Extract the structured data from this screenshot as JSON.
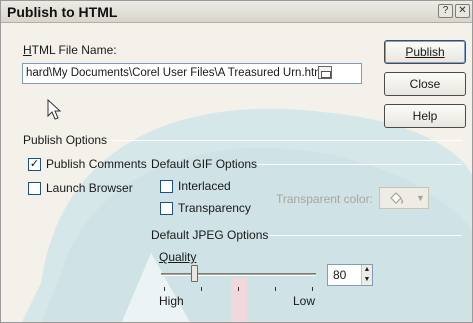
{
  "window": {
    "title": "Publish to HTML",
    "help_glyph": "?",
    "close_glyph": "✕"
  },
  "file": {
    "label": "HTML File Name:",
    "value": "hard\\My Documents\\Corel User Files\\A Treasured Urn.htm"
  },
  "buttons": {
    "publish": "Publish",
    "close": "Close",
    "help": "Help"
  },
  "publish_options": {
    "label": "Publish Options",
    "publish_comments": {
      "label": "Publish Comments",
      "checked": true
    },
    "launch_browser": {
      "label": "Launch Browser",
      "checked": false
    }
  },
  "gif_options": {
    "label": "Default GIF Options",
    "interlaced": {
      "label": "Interlaced",
      "checked": false
    },
    "transparency": {
      "label": "Transparency",
      "checked": false
    },
    "transparent_color": "Transparent color:"
  },
  "jpeg_options": {
    "label": "Default JPEG Options",
    "quality_label": "Quality",
    "quality_value": "80",
    "high": "High",
    "low": "Low"
  },
  "icons": [
    "mouse-pointer-icon",
    "paint-bucket-icon",
    "folder-icon"
  ],
  "colors": {
    "background_art": "#cfe2e5",
    "accent": "#7aa2d6"
  }
}
